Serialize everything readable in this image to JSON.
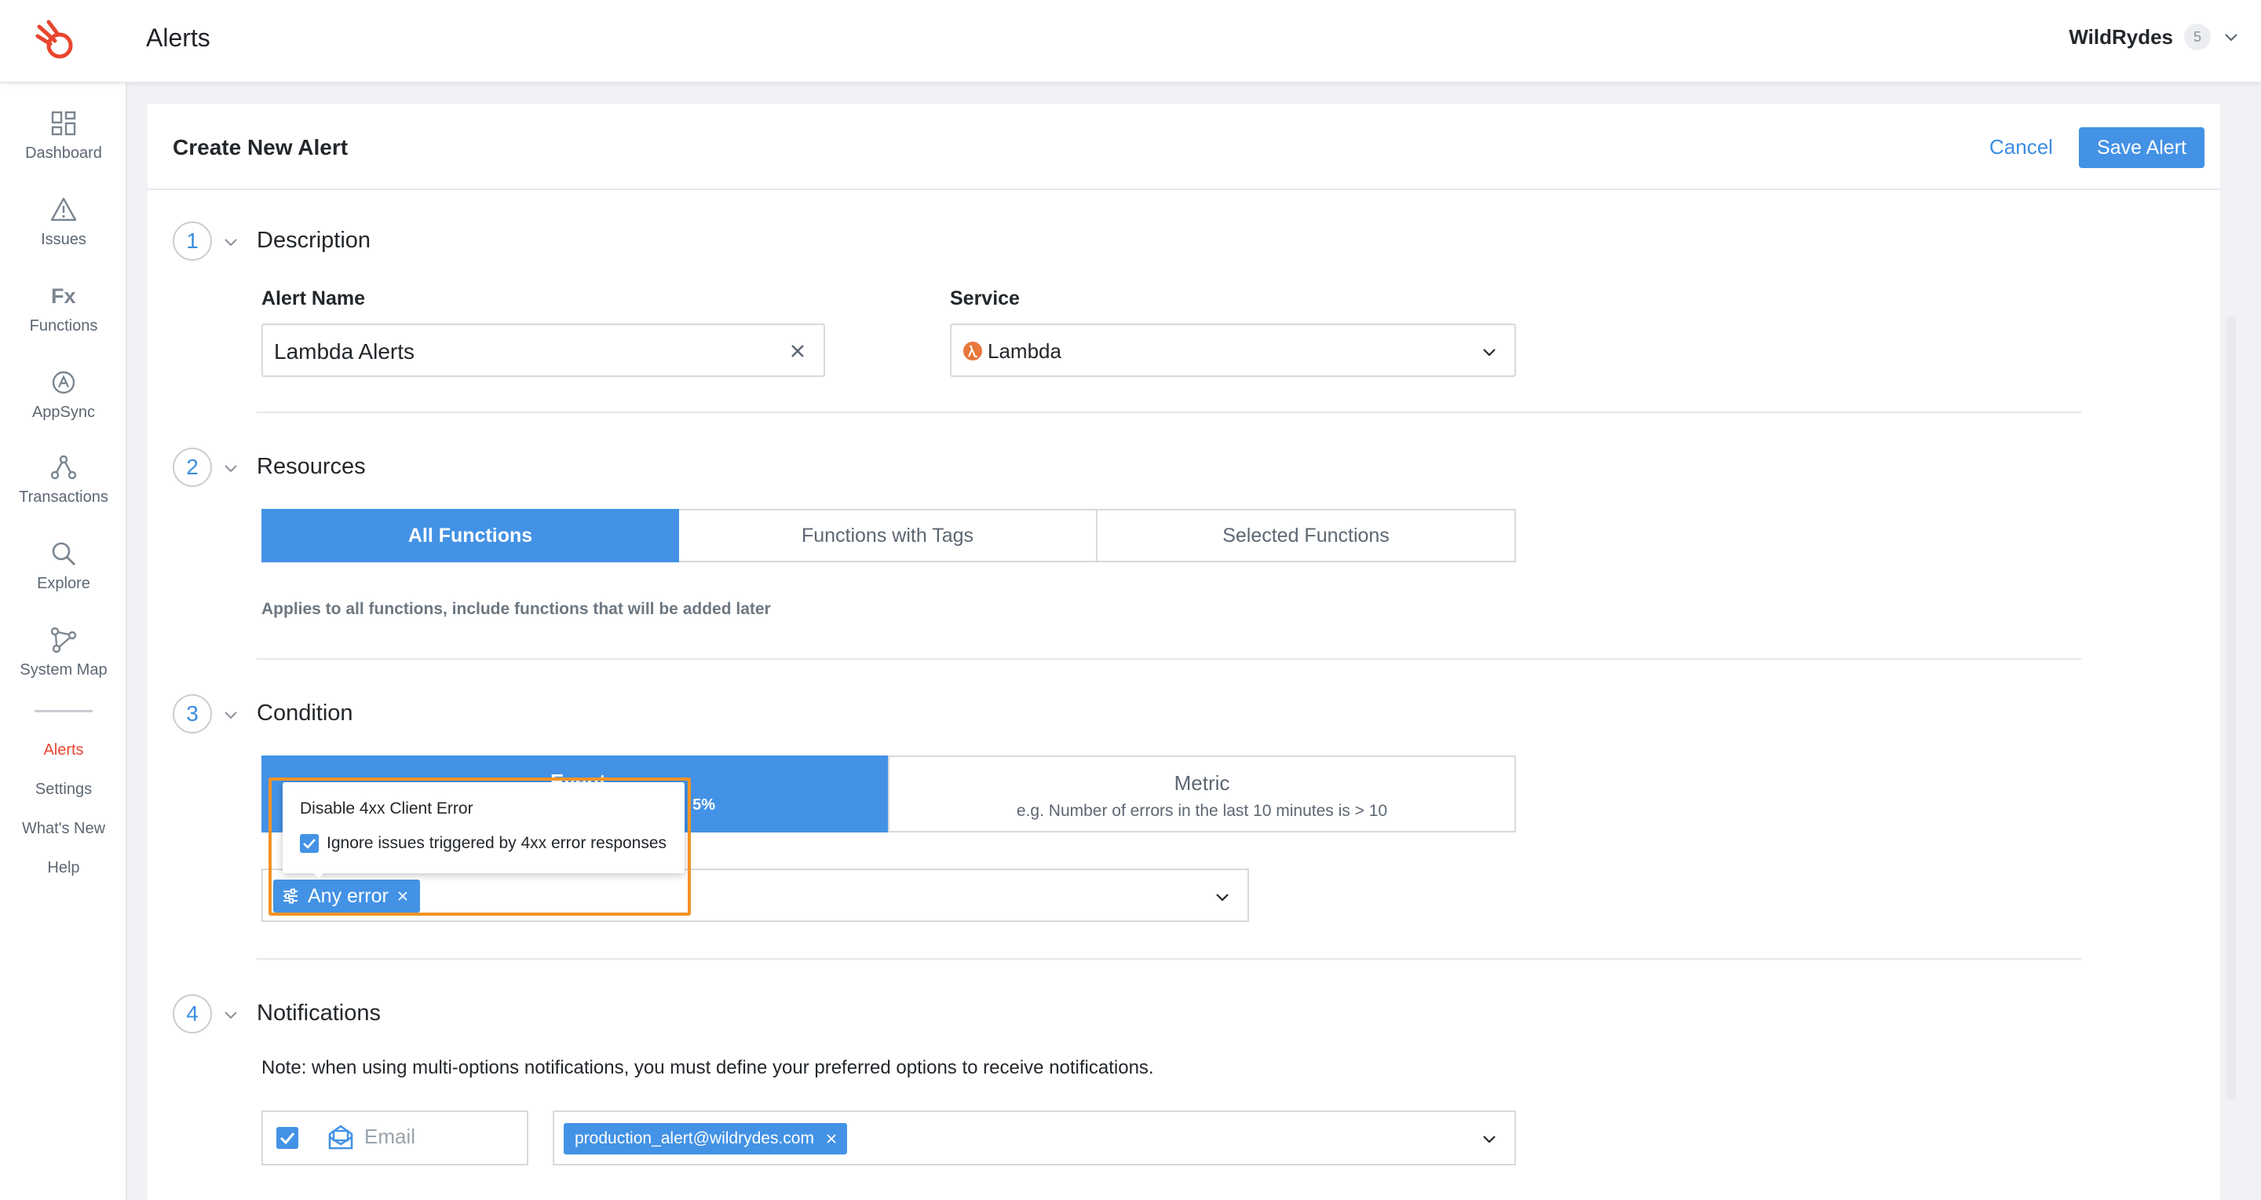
{
  "header": {
    "title": "Alerts",
    "user": "WildRydes",
    "user_badge": "5"
  },
  "sidebar": {
    "items": [
      {
        "label": "Dashboard",
        "icon": "dashboard-icon"
      },
      {
        "label": "Issues",
        "icon": "warning-icon"
      },
      {
        "label": "Functions",
        "icon": "fx-icon"
      },
      {
        "label": "AppSync",
        "icon": "appsync-icon"
      },
      {
        "label": "Transactions",
        "icon": "transactions-icon"
      },
      {
        "label": "Explore",
        "icon": "search-icon"
      },
      {
        "label": "System Map",
        "icon": "system-map-icon"
      }
    ],
    "links": [
      "Alerts",
      "Settings",
      "What's New",
      "Help"
    ],
    "active_link": "Alerts"
  },
  "form": {
    "title": "Create New Alert",
    "cancel_label": "Cancel",
    "save_label": "Save Alert",
    "sections": {
      "description": {
        "number": "1",
        "title": "Description",
        "alert_name_label": "Alert Name",
        "alert_name_value": "Lambda Alerts",
        "service_label": "Service",
        "service_value": "Lambda"
      },
      "resources": {
        "number": "2",
        "title": "Resources",
        "options": [
          "All Functions",
          "Functions with Tags",
          "Selected Functions"
        ],
        "selected": "All Functions",
        "helper": "Applies to all functions, include functions that will be added later"
      },
      "condition": {
        "number": "3",
        "title": "Condition",
        "event_label": "Event",
        "event_sub_visible": "5%",
        "metric_label": "Metric",
        "metric_sub": "e.g. Number of errors in the last 10 minutes is > 10",
        "error_tag": "Any error",
        "popover_title": "Disable 4xx Client Error",
        "popover_option": "Ignore issues triggered by 4xx error responses",
        "popover_checked": true
      },
      "notifications": {
        "number": "4",
        "title": "Notifications",
        "note": "Note: when using multi-options notifications, you must define your preferred options to receive notifications.",
        "channel_label": "Email",
        "channel_checked": true,
        "recipient": "production_alert@wildrydes.com"
      }
    }
  },
  "colors": {
    "accent": "#4392e5",
    "brand": "#e8462f",
    "highlight": "#f39325"
  }
}
